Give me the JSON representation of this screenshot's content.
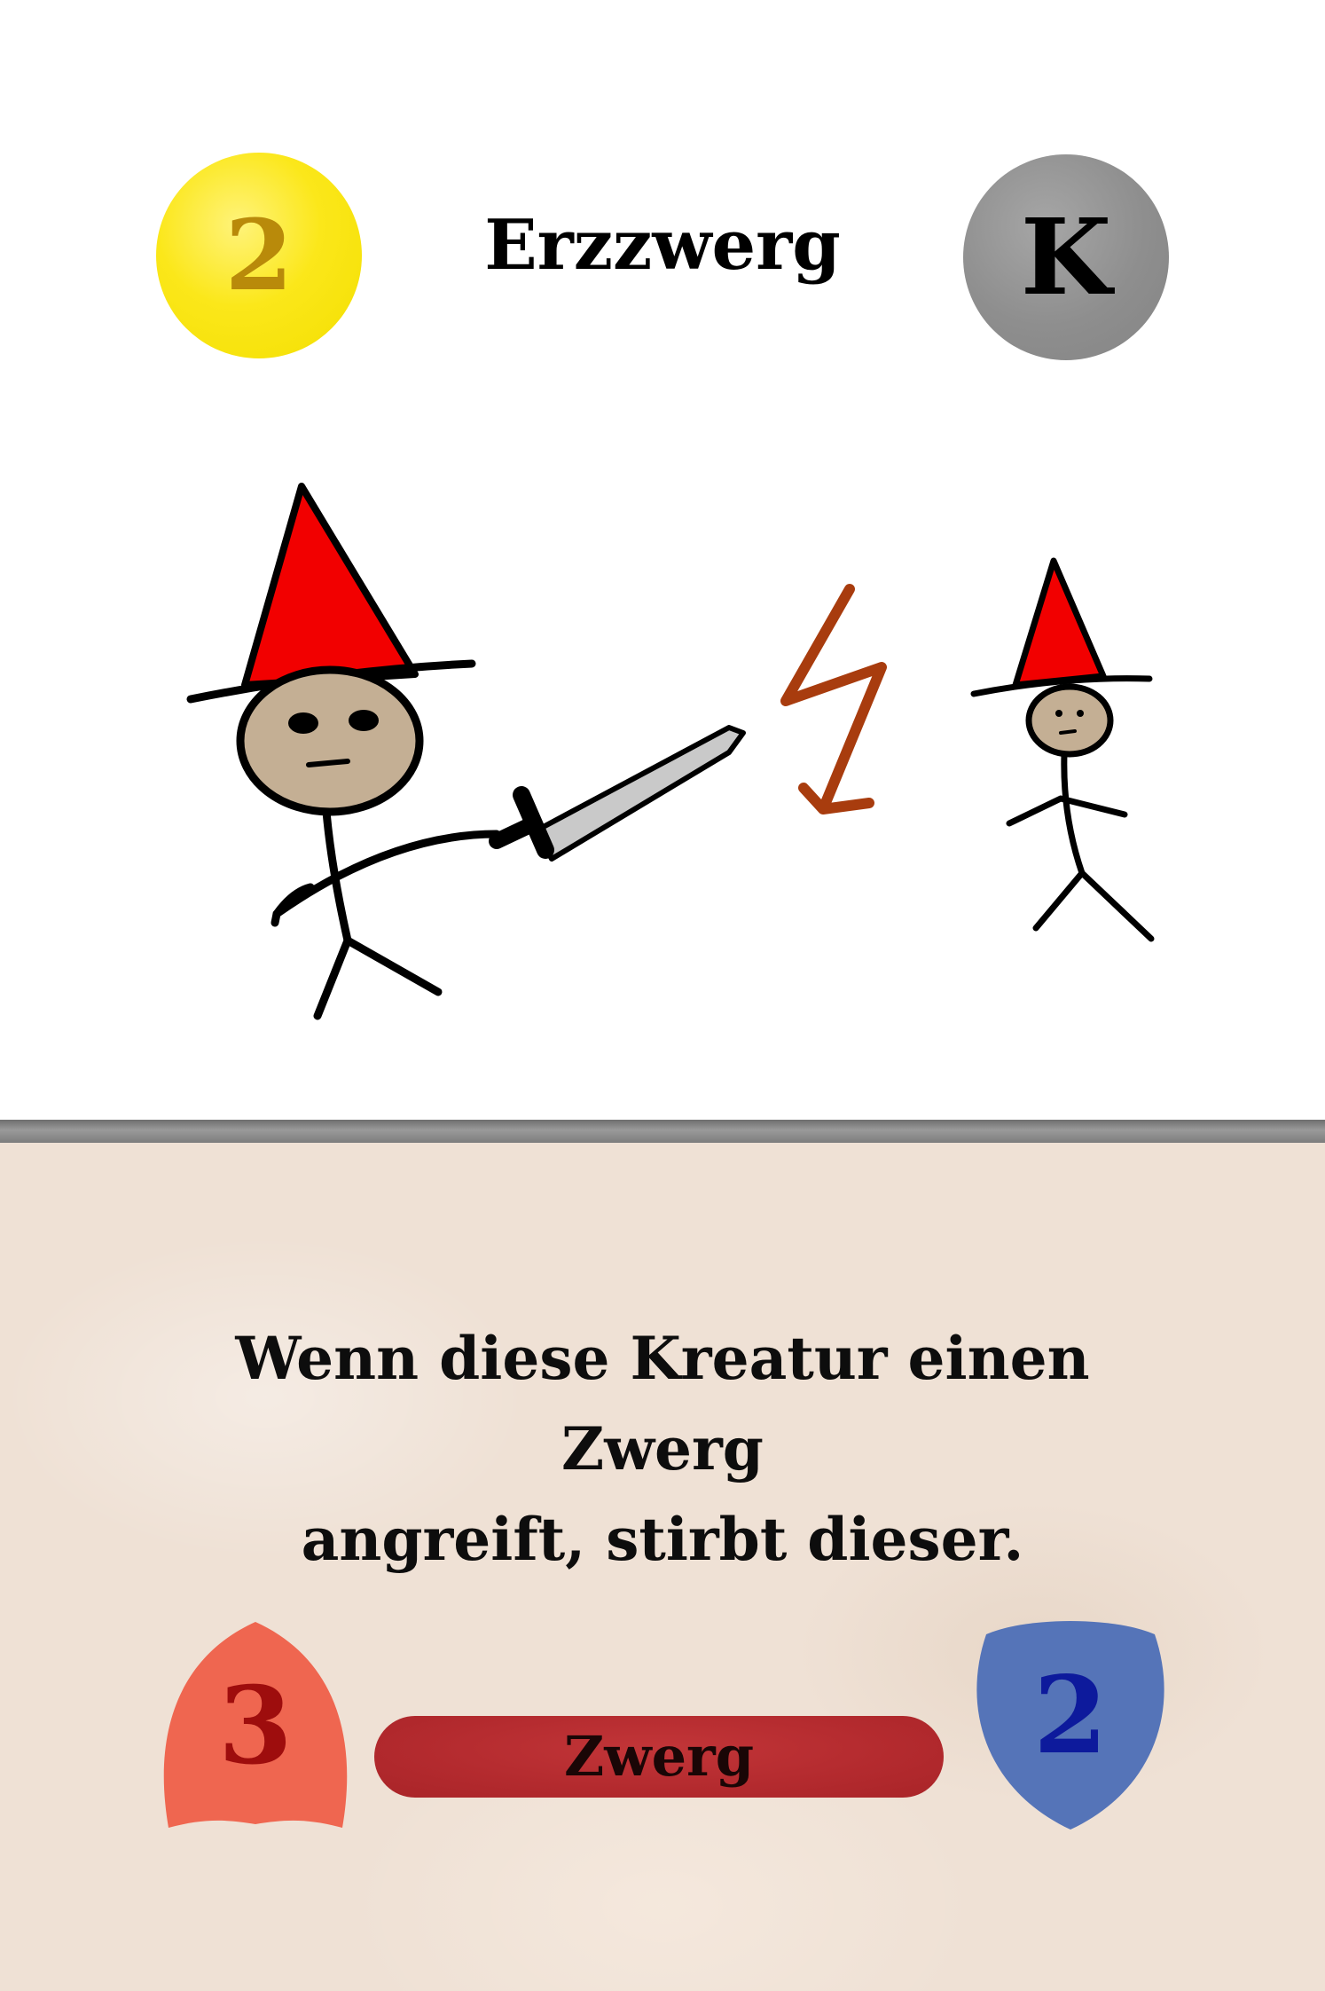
{
  "card": {
    "cost": "2",
    "type_symbol": "K",
    "name": "Erzzwerg",
    "ability_lines": [
      "Wenn diese Kreatur einen Zwerg",
      "angreift, stirbt dieser."
    ],
    "attack": "3",
    "defense": "2",
    "race": "Zwerg"
  },
  "colors": {
    "cost_circle": "#f7e40a",
    "type_circle": "#8e8e8e",
    "attack_shape": "#ef6650",
    "defense_shape": "#5574b8",
    "race_bar": "#b32a2e",
    "text_panel": "#efe1d5"
  },
  "illustration": {
    "elements": [
      "big-dwarf-with-sword",
      "lightning-bolt",
      "small-dwarf"
    ]
  }
}
